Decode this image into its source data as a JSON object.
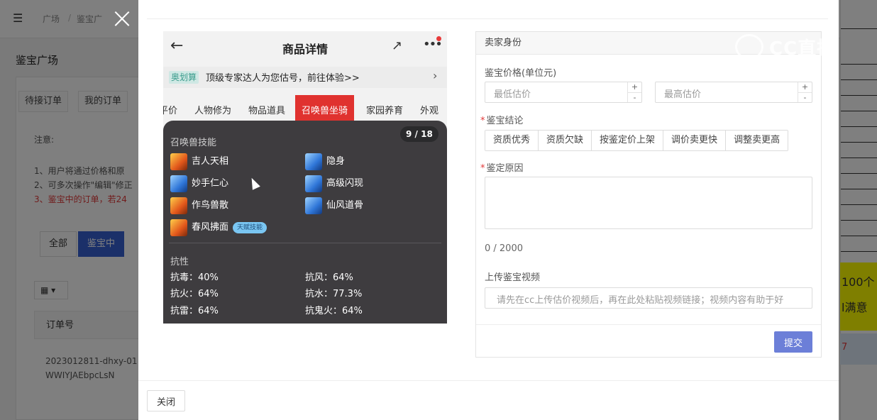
{
  "background": {
    "breadcrumb": [
      "广场",
      "/",
      "鉴宝广"
    ],
    "page_title": "鉴宝广场",
    "tabs": [
      "待接订单",
      "我的订单"
    ],
    "note_title": "注意:",
    "notes": [
      "1、用户将通过价格和原",
      "2、可多次操作\"编辑\"修正",
      "3、鉴宝中的订单，若24"
    ],
    "filters": [
      "全部",
      "鉴宝中"
    ],
    "view_icon": "grid-icon",
    "table_header": "订单号",
    "order_line1": "2023012811-dhxy-01",
    "order_line2": "WWIYJAEbpcLsN",
    "right_yellow_line1": "100个",
    "right_yellow_line2": "l满意",
    "right_blue_text": "7"
  },
  "modal": {
    "close_icon": "×",
    "close_button": "关闭",
    "phone": {
      "title": "商品详情",
      "back_icon": "←",
      "share_icon": "↗",
      "more_icon": "•••",
      "banner_badge": "奥划算",
      "banner_text": "顶级专家达人为您估号，前往体验>>",
      "banner_arrow": "›",
      "tabs": [
        "平价",
        "人物修为",
        "物品道具",
        "召唤兽坐骑",
        "家园养育",
        "外观"
      ],
      "active_tab": "召唤兽坐骑",
      "count": "9 / 18",
      "skills_title": "召唤兽技能",
      "skills": [
        {
          "name": "吉人天相",
          "icon": "fire"
        },
        {
          "name": "隐身",
          "icon": "blue"
        },
        {
          "name": "妙手仁心",
          "icon": "blue"
        },
        {
          "name": "高级闪现",
          "icon": "blue"
        },
        {
          "name": "作鸟兽散",
          "icon": "fire"
        },
        {
          "name": "仙风道骨",
          "icon": "blue"
        },
        {
          "name": "春风拂面",
          "icon": "fire"
        }
      ],
      "skill_tag": "天赋技能",
      "resist_title": "抗性",
      "resists": [
        "抗毒：40%",
        "抗风：64%",
        "抗火：64%",
        "抗水：77.3%",
        "抗雷：64%",
        "抗鬼火：64%"
      ]
    },
    "form": {
      "section_title": "卖家身份",
      "price_label": "鉴宝价格(单位元)",
      "min_placeholder": "最低估价",
      "max_placeholder": "最高估价",
      "conclusion_label": "鉴宝结论",
      "conclusions": [
        "资质优秀",
        "资质欠缺",
        "按鉴定价上架",
        "调价卖更快",
        "调整卖更高"
      ],
      "reason_label": "鉴定原因",
      "counter": "0 / 2000",
      "video_label": "上传鉴宝视频",
      "video_placeholder": "请先在cc上传估价视频后，再在此处粘贴视频链接；视频内容有助于好",
      "submit_button": "提交"
    }
  },
  "watermark": "CC直播"
}
